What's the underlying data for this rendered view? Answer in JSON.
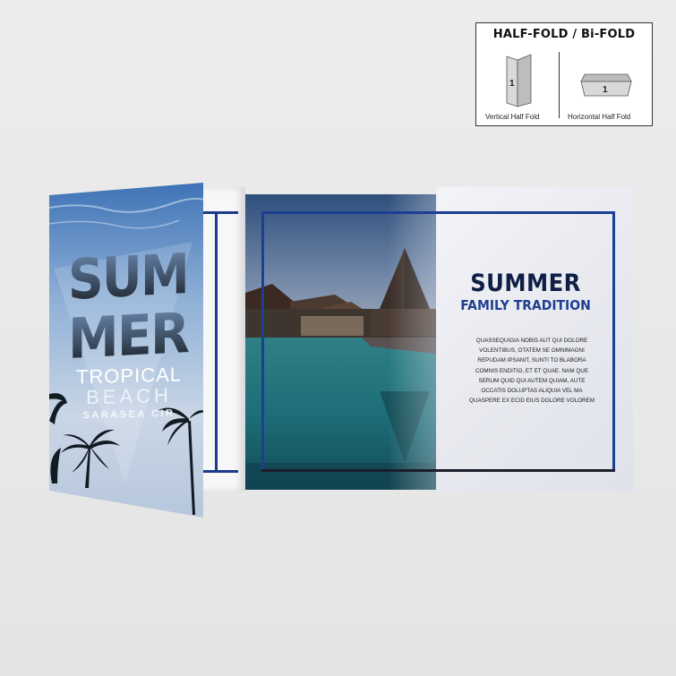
{
  "legend": {
    "title": "HALF-FOLD / Bi-FOLD",
    "vertical_caption": "Vertical Half Fold",
    "horizontal_caption": "Horizontal Half Fold",
    "vertical_number": "1",
    "horizontal_number": "1"
  },
  "cover": {
    "headline_line1": "SUM",
    "headline_line2": "MER",
    "subtitle1": "TROPICAL",
    "subtitle2": "BEACH",
    "subtitle3": "SARASEA CIR"
  },
  "inner": {
    "title": "SUMMER",
    "subtitle": "FAMILY TRADITION",
    "body": "QUASSEQUIGIA NOBIS AUT QUI DOLORE VOLENTIBUS, OTATEM SE OMNIMAGNI REPUDAM IPSANIT, SUNTI TO BLABORA COMNIS ENDITIO, ET ET QUAE. NAM QUE SERUM QUID QUI AUTEM QUIAM, AUTE OCCATIS DOLUPTAS ALIQUIA VEL MA QUASPERE EX ECID EIUS DOLORE VOLOREM"
  },
  "colors": {
    "brand_blue": "#1b3f93",
    "title_navy": "#0f1f46",
    "pool_teal": "#1d6e78"
  }
}
